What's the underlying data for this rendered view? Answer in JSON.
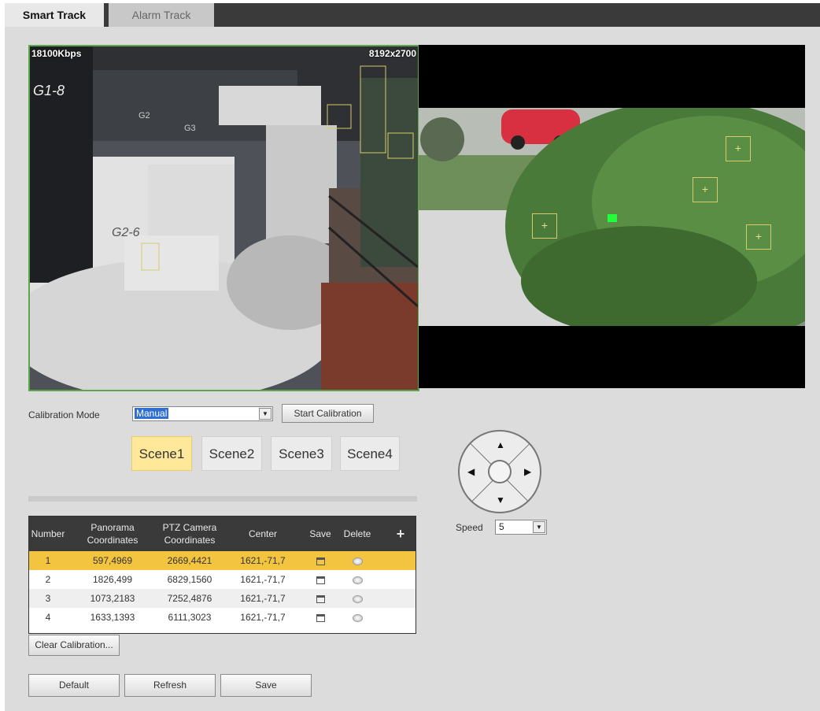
{
  "tabs": [
    {
      "label": "Smart Track",
      "active": true
    },
    {
      "label": "Alarm Track",
      "active": false
    }
  ],
  "video": {
    "bitrate": "18100Kbps",
    "resolution": "8192x2700",
    "left_labels": [
      "G1-8",
      "G2-6",
      "G2",
      "G3"
    ]
  },
  "calibration": {
    "mode_label": "Calibration Mode",
    "mode_value": "Manual",
    "start_button": "Start Calibration",
    "scenes": [
      "Scene1",
      "Scene2",
      "Scene3",
      "Scene4"
    ],
    "active_scene": "Scene1"
  },
  "table": {
    "headers": {
      "number": "Number",
      "panorama": [
        "Panorama",
        "Coordinates"
      ],
      "ptz": [
        "PTZ Camera",
        "Coordinates"
      ],
      "center": "Center",
      "save": "Save",
      "delete": "Delete",
      "add": "+"
    },
    "rows": [
      {
        "number": "1",
        "panorama": "597,4969",
        "ptz": "2669,4421",
        "center": "1621,-71,7",
        "selected": true
      },
      {
        "number": "2",
        "panorama": "1826,499",
        "ptz": "6829,1560",
        "center": "1621,-71,7",
        "selected": false
      },
      {
        "number": "3",
        "panorama": "1073,2183",
        "ptz": "7252,4876",
        "center": "1621,-71,7",
        "selected": false
      },
      {
        "number": "4",
        "panorama": "1633,1393",
        "ptz": "6111,3023",
        "center": "1621,-71,7",
        "selected": false
      }
    ]
  },
  "clear_button": "Clear Calibration...",
  "bottom_buttons": {
    "default": "Default",
    "refresh": "Refresh",
    "save": "Save"
  },
  "ptz": {
    "speed_label": "Speed",
    "speed_value": "5"
  },
  "colors": {
    "accent_selected": "#f2c440",
    "scene_active": "#ffe89a",
    "tab_bar": "#3a3a3a",
    "video_border": "#5aa84a"
  },
  "icons": {
    "save": "save-icon",
    "delete": "delete-icon",
    "add": "plus-icon"
  }
}
